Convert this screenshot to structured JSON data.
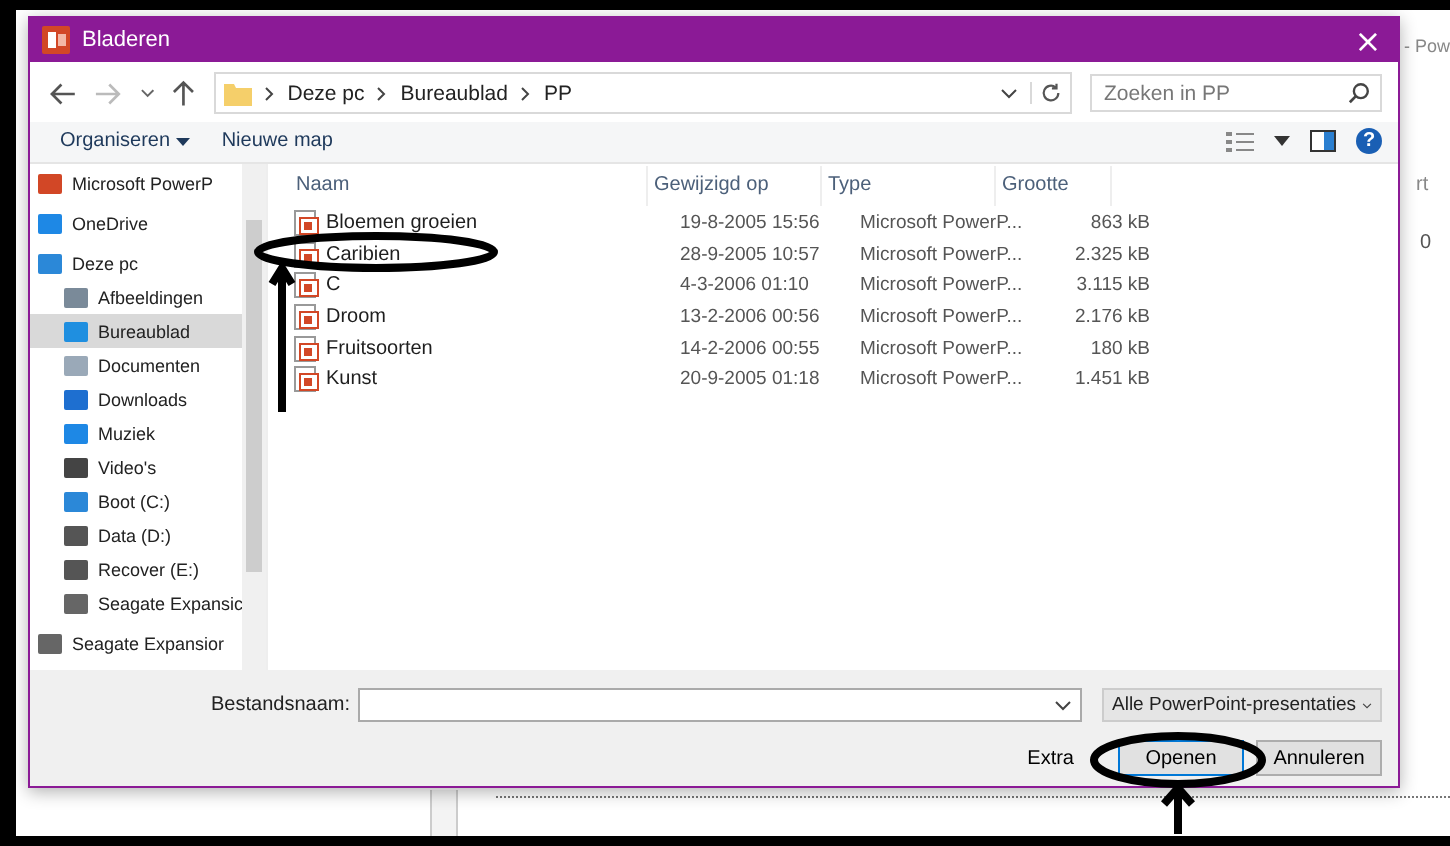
{
  "background_app": {
    "title_fragment": "- Pow",
    "ribbon_fragment": "rt",
    "ruler_mark": "0"
  },
  "window": {
    "title": "Bladeren",
    "close": "×"
  },
  "address": {
    "crumbs": [
      "Deze pc",
      "Bureaublad",
      "PP"
    ],
    "search_placeholder": "Zoeken in PP"
  },
  "toolbar": {
    "organize": "Organiseren",
    "new_folder": "Nieuwe map",
    "help": "?"
  },
  "sidebar": {
    "items": [
      {
        "label": "Microsoft PowerP",
        "kind": "powerpoint",
        "selected": false
      },
      {
        "label": "OneDrive",
        "kind": "cloud",
        "selected": false
      },
      {
        "label": "Deze pc",
        "kind": "computer",
        "selected": false,
        "children": [
          {
            "label": "Afbeeldingen",
            "kind": "pictures",
            "selected": false
          },
          {
            "label": "Bureaublad",
            "kind": "desktop",
            "selected": true
          },
          {
            "label": "Documenten",
            "kind": "documents",
            "selected": false
          },
          {
            "label": "Downloads",
            "kind": "download",
            "selected": false
          },
          {
            "label": "Muziek",
            "kind": "music",
            "selected": false
          },
          {
            "label": "Video's",
            "kind": "video",
            "selected": false
          },
          {
            "label": "Boot (C:)",
            "kind": "system-drive",
            "selected": false
          },
          {
            "label": "Data (D:)",
            "kind": "drive",
            "selected": false
          },
          {
            "label": "Recover (E:)",
            "kind": "drive",
            "selected": false
          },
          {
            "label": "Seagate Expansic",
            "kind": "external",
            "selected": false
          }
        ]
      },
      {
        "label": "Seagate Expansior",
        "kind": "external",
        "selected": false
      }
    ]
  },
  "table": {
    "columns": [
      "Naam",
      "Gewijzigd op",
      "Type",
      "Grootte"
    ],
    "rows": [
      {
        "name": "Bloemen groeien",
        "modified": "19-8-2005 15:56",
        "type": "Microsoft PowerP...",
        "size": "863 kB"
      },
      {
        "name": "Caribien",
        "modified": "28-9-2005 10:57",
        "type": "Microsoft PowerP...",
        "size": "2.325 kB"
      },
      {
        "name": "C",
        "modified": "4-3-2006 01:10",
        "type": "Microsoft PowerP...",
        "size": "3.115 kB"
      },
      {
        "name": "Droom",
        "modified": "13-2-2006 00:56",
        "type": "Microsoft PowerP...",
        "size": "2.176 kB"
      },
      {
        "name": "Fruitsoorten",
        "modified": "14-2-2006 00:55",
        "type": "Microsoft PowerP...",
        "size": "180 kB"
      },
      {
        "name": "Kunst",
        "modified": "20-9-2005 01:18",
        "type": "Microsoft PowerP...",
        "size": "1.451 kB"
      }
    ]
  },
  "footer": {
    "filename_label": "Bestandsnaam:",
    "filter": "Alle PowerPoint-presentaties",
    "extra": "Extra",
    "open": "Openen",
    "cancel": "Annuleren"
  }
}
